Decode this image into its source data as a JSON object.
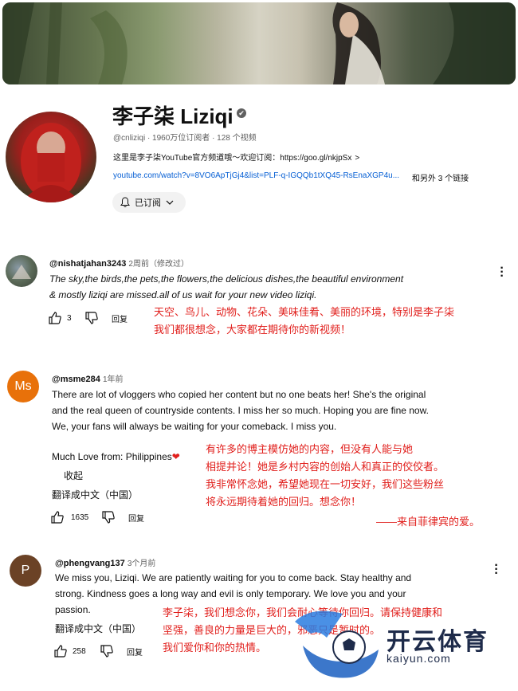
{
  "channel": {
    "name": "李子柒 Liziqi",
    "verified_icon": "✔",
    "meta": "@cnliziqi · 1960万位订阅者 · 128 个视频",
    "description": "这里是李子柒YouTube官方频道哦～欢迎订阅：https://goo.gl/nkjpSx",
    "link": "youtube.com/watch?v=8VO6ApTjGj4&list=PLF-q-IGQQb1tXQ45-RsEnaXGP4u...",
    "more_links": "和另外 3 个链接",
    "subscribe_label": "已订阅"
  },
  "comments": [
    {
      "user": "@nishatjahan3243",
      "time": "2周前（修改过）",
      "lines": [
        "The sky,the birds,the pets,the flowers,the delicious dishes,the beautiful environment",
        "& mostly liziqi are missed.all of us wait for your new video liziqi."
      ],
      "likes": "3",
      "reply": "回复",
      "translation": [
        "天空、鸟儿、动物、花朵、美味佳肴、美丽的环境，特别是李子柒",
        "我们都很想念，大家都在期待你的新视频！"
      ]
    },
    {
      "user": "@msme284",
      "time": "1年前",
      "avatar_text": "Ms",
      "lines": [
        "There are lot of vloggers who copied her content but no one beats her! She's the original",
        "and the real queen of countryside contents. I miss her so much. Hoping you are fine now.",
        "We, your fans will always be waiting for your comeback. I miss you."
      ],
      "extra_line": "Much Love from: Philippines",
      "heart": "❤",
      "collapse": "收起",
      "translate": "翻译成中文（中国）",
      "likes": "1635",
      "reply": "回复",
      "translation": [
        "有许多的博主模仿她的内容，但没有人能与她",
        "相提并论！她是乡村内容的创始人和真正的佼佼者。",
        "我非常怀念她，希望她现在一切安好，我们这些粉丝",
        "将永远期待着她的回归。想念你！",
        "——来自菲律宾的爱。"
      ]
    },
    {
      "user": "@phengvang137",
      "time": "3个月前",
      "avatar_text": "P",
      "lines": [
        "We miss you, Liziqi. We are patiently waiting for you to come back. Stay healthy and",
        "strong. Kindness goes a long way and evil is only temporary. We love you and your",
        "passion."
      ],
      "translate": "翻译成中文（中国）",
      "likes": "258",
      "reply": "回复",
      "translation": [
        "李子柒，我们想念你，我们会耐心等待你回归。请保持健康和",
        "坚强，善良的力量是巨大的，邪恶只是暂时的。",
        "我们爱你和你的热情。"
      ]
    }
  ],
  "watermark": {
    "title": "开云体育",
    "subtitle": "kaiyun.com"
  },
  "colors": {
    "translation_red": "#e1201d",
    "link_blue": "#065fd4",
    "ms_avatar": "#e8710a",
    "p_avatar": "#6b4226"
  }
}
